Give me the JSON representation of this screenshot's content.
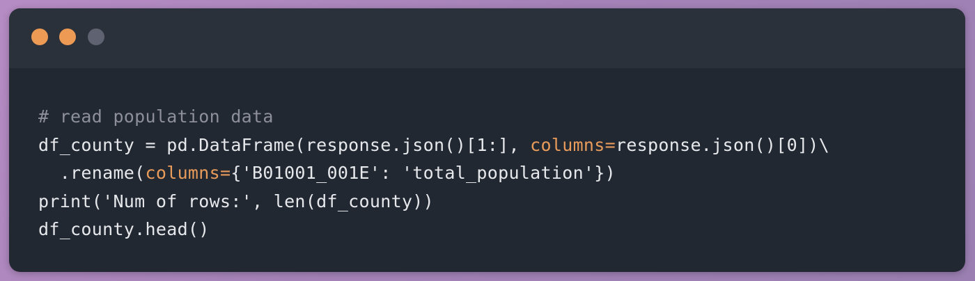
{
  "window": {
    "controls": [
      {
        "name": "close",
        "color": "#ed9a55"
      },
      {
        "name": "minimize",
        "color": "#ed9a55"
      },
      {
        "name": "maximize",
        "color": "#5f6270"
      }
    ]
  },
  "code": {
    "lines": [
      [
        {
          "t": "# read population data",
          "k": "comment"
        }
      ],
      [
        {
          "t": "df_county = pd.DataFrame(response.json()[1:], ",
          "k": "plain"
        },
        {
          "t": "columns=",
          "k": "kw"
        },
        {
          "t": "response.json()[0])\\",
          "k": "plain"
        }
      ],
      [
        {
          "t": "  .rename(",
          "k": "plain"
        },
        {
          "t": "columns=",
          "k": "kw"
        },
        {
          "t": "{'B01001_001E': 'total_population'})",
          "k": "plain"
        }
      ],
      [
        {
          "t": "print('Num of rows:', len(df_county))",
          "k": "plain"
        }
      ],
      [
        {
          "t": "df_county.head()",
          "k": "plain"
        }
      ]
    ]
  }
}
